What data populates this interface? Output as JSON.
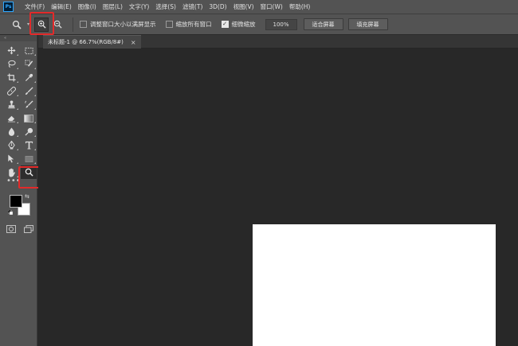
{
  "app": {
    "logo_text": "Ps"
  },
  "menu": {
    "items": [
      "文件(F)",
      "编辑(E)",
      "图像(I)",
      "图层(L)",
      "文字(Y)",
      "选择(S)",
      "滤镜(T)",
      "3D(D)",
      "视图(V)",
      "窗口(W)",
      "帮助(H)"
    ]
  },
  "options": {
    "tool_icon": "zoom-icon",
    "zoom_in_icon": "zoom-in-icon",
    "zoom_out_icon": "zoom-out-icon",
    "resize_windows_label": "调整窗口大小以满屏显示",
    "resize_windows_checked": false,
    "zoom_all_label": "缩放所有窗口",
    "zoom_all_checked": false,
    "scrubby_zoom_label": "细微缩放",
    "scrubby_zoom_checked": true,
    "zoom_percent": "100%",
    "fit_screen_label": "适合屏幕",
    "fill_screen_label": "填充屏幕"
  },
  "toolbar": {
    "header": "«",
    "more_tools": "•••",
    "foreground_color": "#000000",
    "background_color": "#ffffff",
    "swap_symbol": "⇆"
  },
  "document": {
    "tab_title": "未标题-1 @ 66.7%(RGB/8#)",
    "close_symbol": "×",
    "canvas_color": "#ffffff"
  },
  "theme": {
    "highlight_color": "#e32a2a",
    "panel_color": "#535353",
    "workspace_color": "#282828"
  }
}
